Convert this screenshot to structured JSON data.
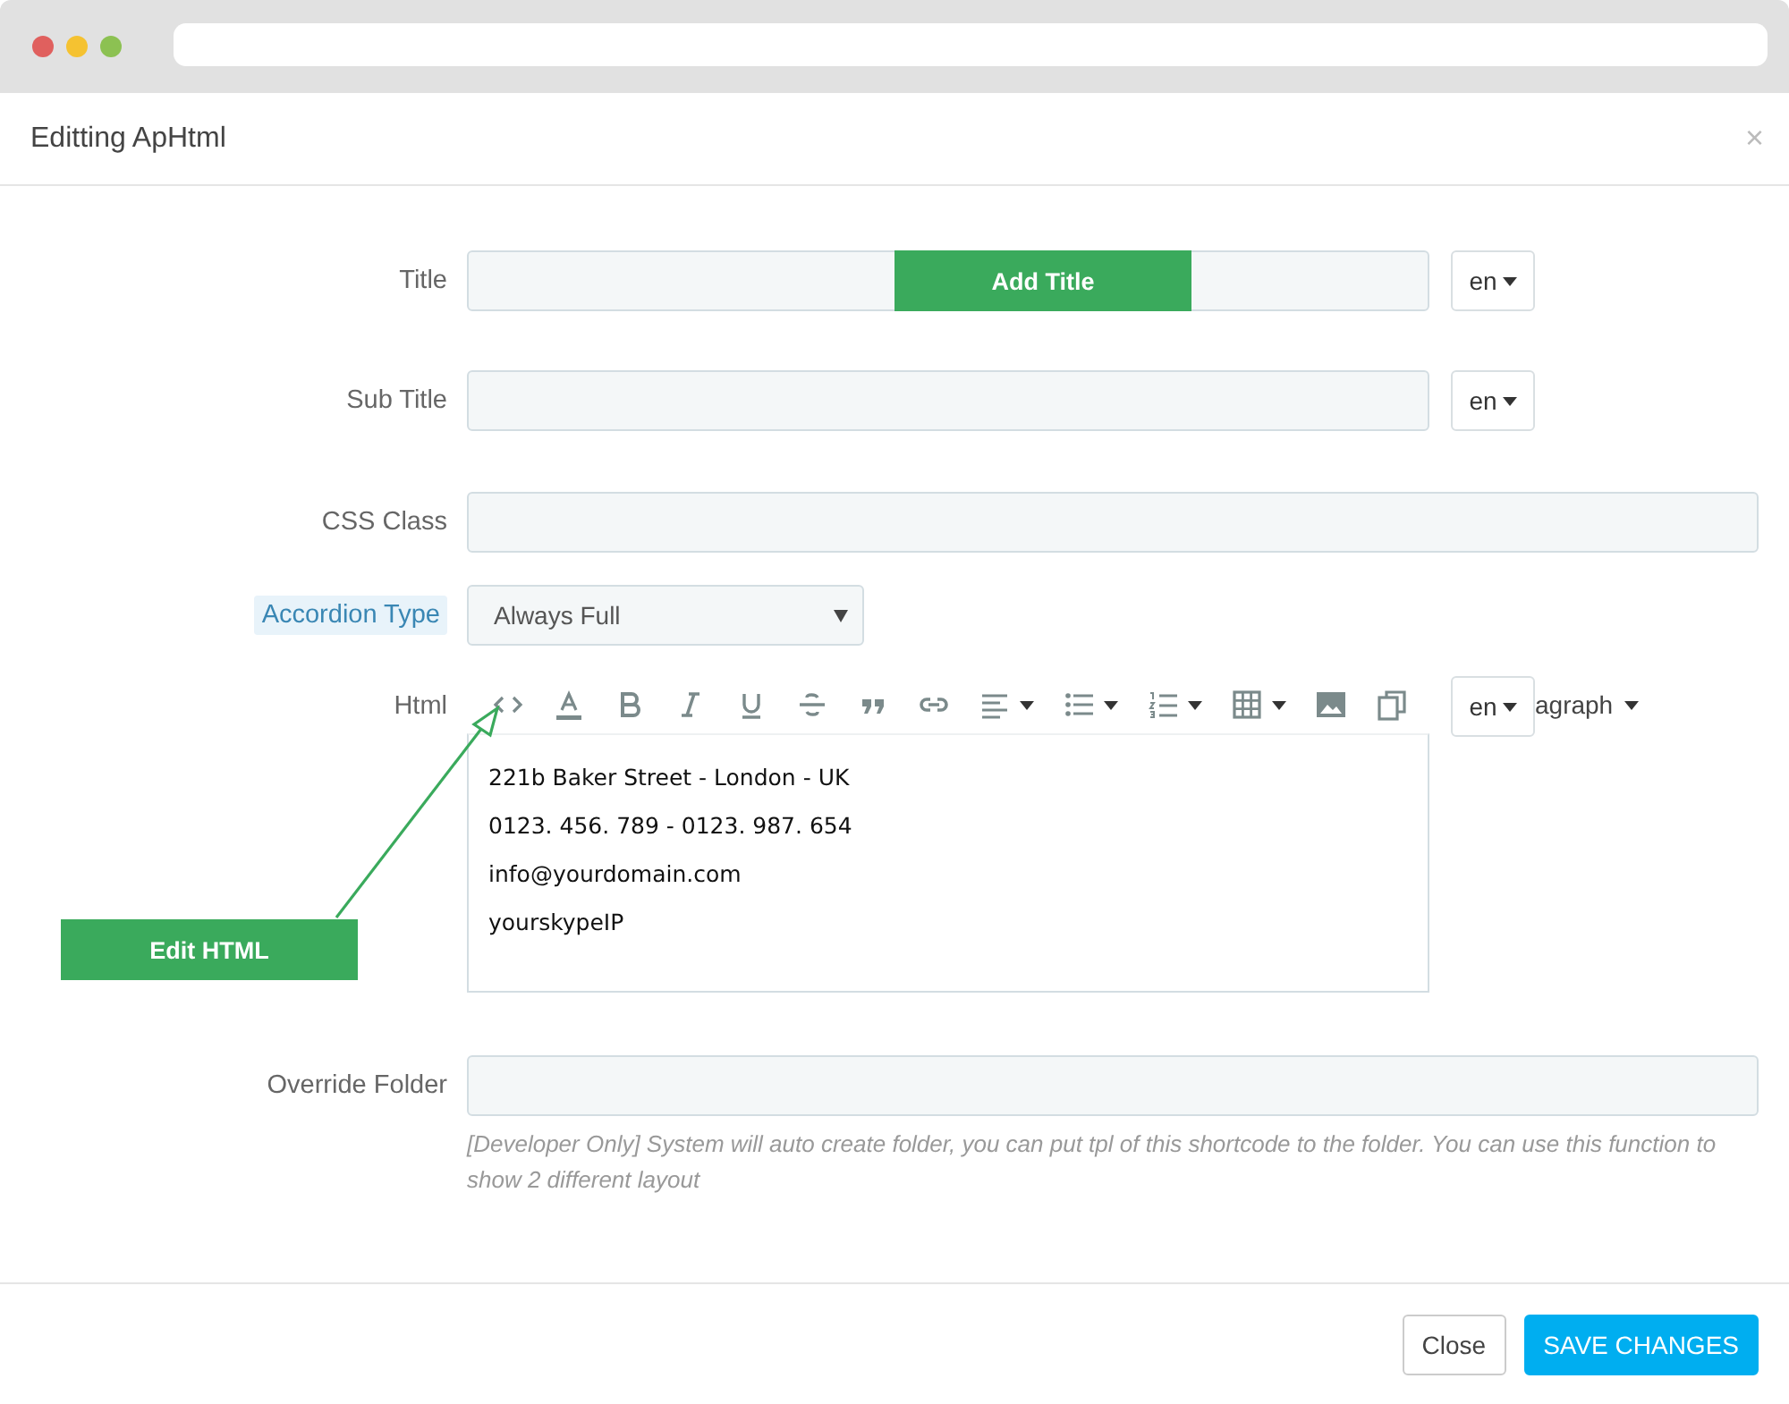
{
  "browser": {
    "traffic_lights": [
      {
        "color": "#e0605e"
      },
      {
        "color": "#f5c231"
      },
      {
        "color": "#8cc152"
      }
    ]
  },
  "modal": {
    "title": "Editting ApHtml",
    "close": "×"
  },
  "fields": [
    {
      "kind": "text",
      "label": "Title",
      "highlighted": false,
      "lang": "en"
    },
    {
      "kind": "text",
      "label": "Sub Title",
      "highlighted": false,
      "lang": "en"
    },
    {
      "kind": "wide",
      "label": "CSS Class",
      "highlighted": false
    },
    {
      "kind": "select",
      "label": "Accordion Type",
      "highlighted": true,
      "value": "Always Full"
    },
    {
      "kind": "editor",
      "label": "Html",
      "highlighted": false,
      "lang": "en",
      "format": "agraph",
      "lines": [
        "221b Baker Street - London - UK",
        "0123. 456. 789 - 0123. 987. 654",
        "info@yourdomain.com",
        "yourskypeIP"
      ]
    },
    {
      "kind": "wide",
      "label": "Override Folder",
      "highlighted": false,
      "help": "[Developer Only] System will auto create folder, you can put tpl of this shortcode to the folder. You can use this function to show 2 different layout"
    }
  ],
  "annotations": [
    {
      "kind": "box",
      "text": "Add Title"
    },
    {
      "kind": "arrow",
      "text": "Edit HTML"
    }
  ],
  "buttons": [
    {
      "kind": "default",
      "label": "Close"
    },
    {
      "kind": "primary",
      "label": "SAVE CHANGES"
    }
  ]
}
